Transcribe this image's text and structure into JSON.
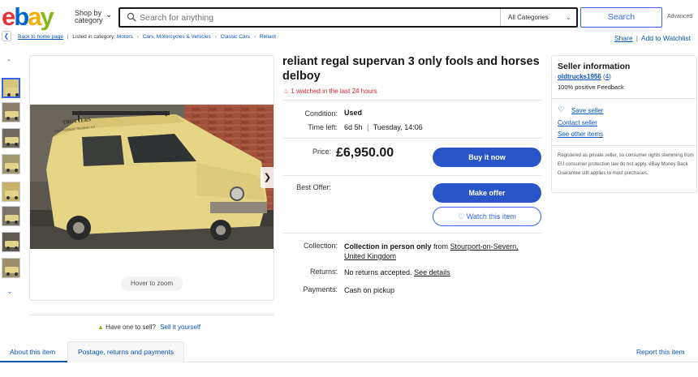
{
  "header": {
    "logo_letters": [
      "e",
      "b",
      "a",
      "y"
    ],
    "shop_by_line1": "Shop by",
    "shop_by_line2": "category",
    "search_placeholder": "Search for anything",
    "category_select": "All Categories",
    "search_button": "Search",
    "advanced": "Advanced"
  },
  "breadcrumb": {
    "back_link": "Back to home page",
    "listed_in": "Listed in category:",
    "categories": [
      "Motors",
      "Cars, Motorcycles & Vehicles",
      "Classic Cars",
      "Reliant"
    ],
    "share": "Share",
    "watchlist": "Add to Watchlist"
  },
  "gallery": {
    "thumbnail_count": 9,
    "hover_to_zoom": "Hover to zoom",
    "sell_prompt": "Have one to sell?",
    "sell_link": "Sell it yourself",
    "van_lettering": [
      "TROTTERS",
      "INDEPENDENT TRADING CO"
    ]
  },
  "item": {
    "title": "reliant regal supervan 3 only fools and horses delboy",
    "watched": "1 watched in the last 24 hours",
    "condition_label": "Condition:",
    "condition_value": "Used",
    "time_left_label": "Time left:",
    "time_left_value": "6d 5h",
    "time_left_end": "Tuesday, 14:06",
    "price_label": "Price:",
    "price": "£6,950.00",
    "buy_now": "Buy it now",
    "best_offer_label": "Best Offer:",
    "make_offer": "Make offer",
    "watch_item": "Watch this item",
    "collection_label": "Collection:",
    "collection_bold": "Collection in person only",
    "collection_from": "from",
    "collection_place": "Stourport-on-Severn, United Kingdom",
    "returns_label": "Returns:",
    "returns_value": "No returns accepted.",
    "returns_link": "See details",
    "payments_label": "Payments:",
    "payments_value": "Cash on pickup"
  },
  "seller": {
    "heading": "Seller information",
    "name": "oldtrucks1956",
    "feedback_count": "4",
    "feedback_percent": "100% positive Feedback",
    "save_seller": "Save seller",
    "contact_seller": "Contact seller",
    "see_other": "See other items",
    "note": "Registered as private seller, so consumer rights stemming from EU consumer protection law do not apply. eBay Money Back Guarantee still applies to most purchases."
  },
  "tabs": {
    "about": "About this item",
    "postage": "Postage, returns and payments",
    "report": "Report this item"
  },
  "colors": {
    "link": "#0654ba",
    "primary_button": "#2955c8",
    "alert_red": "#dd1e31"
  }
}
